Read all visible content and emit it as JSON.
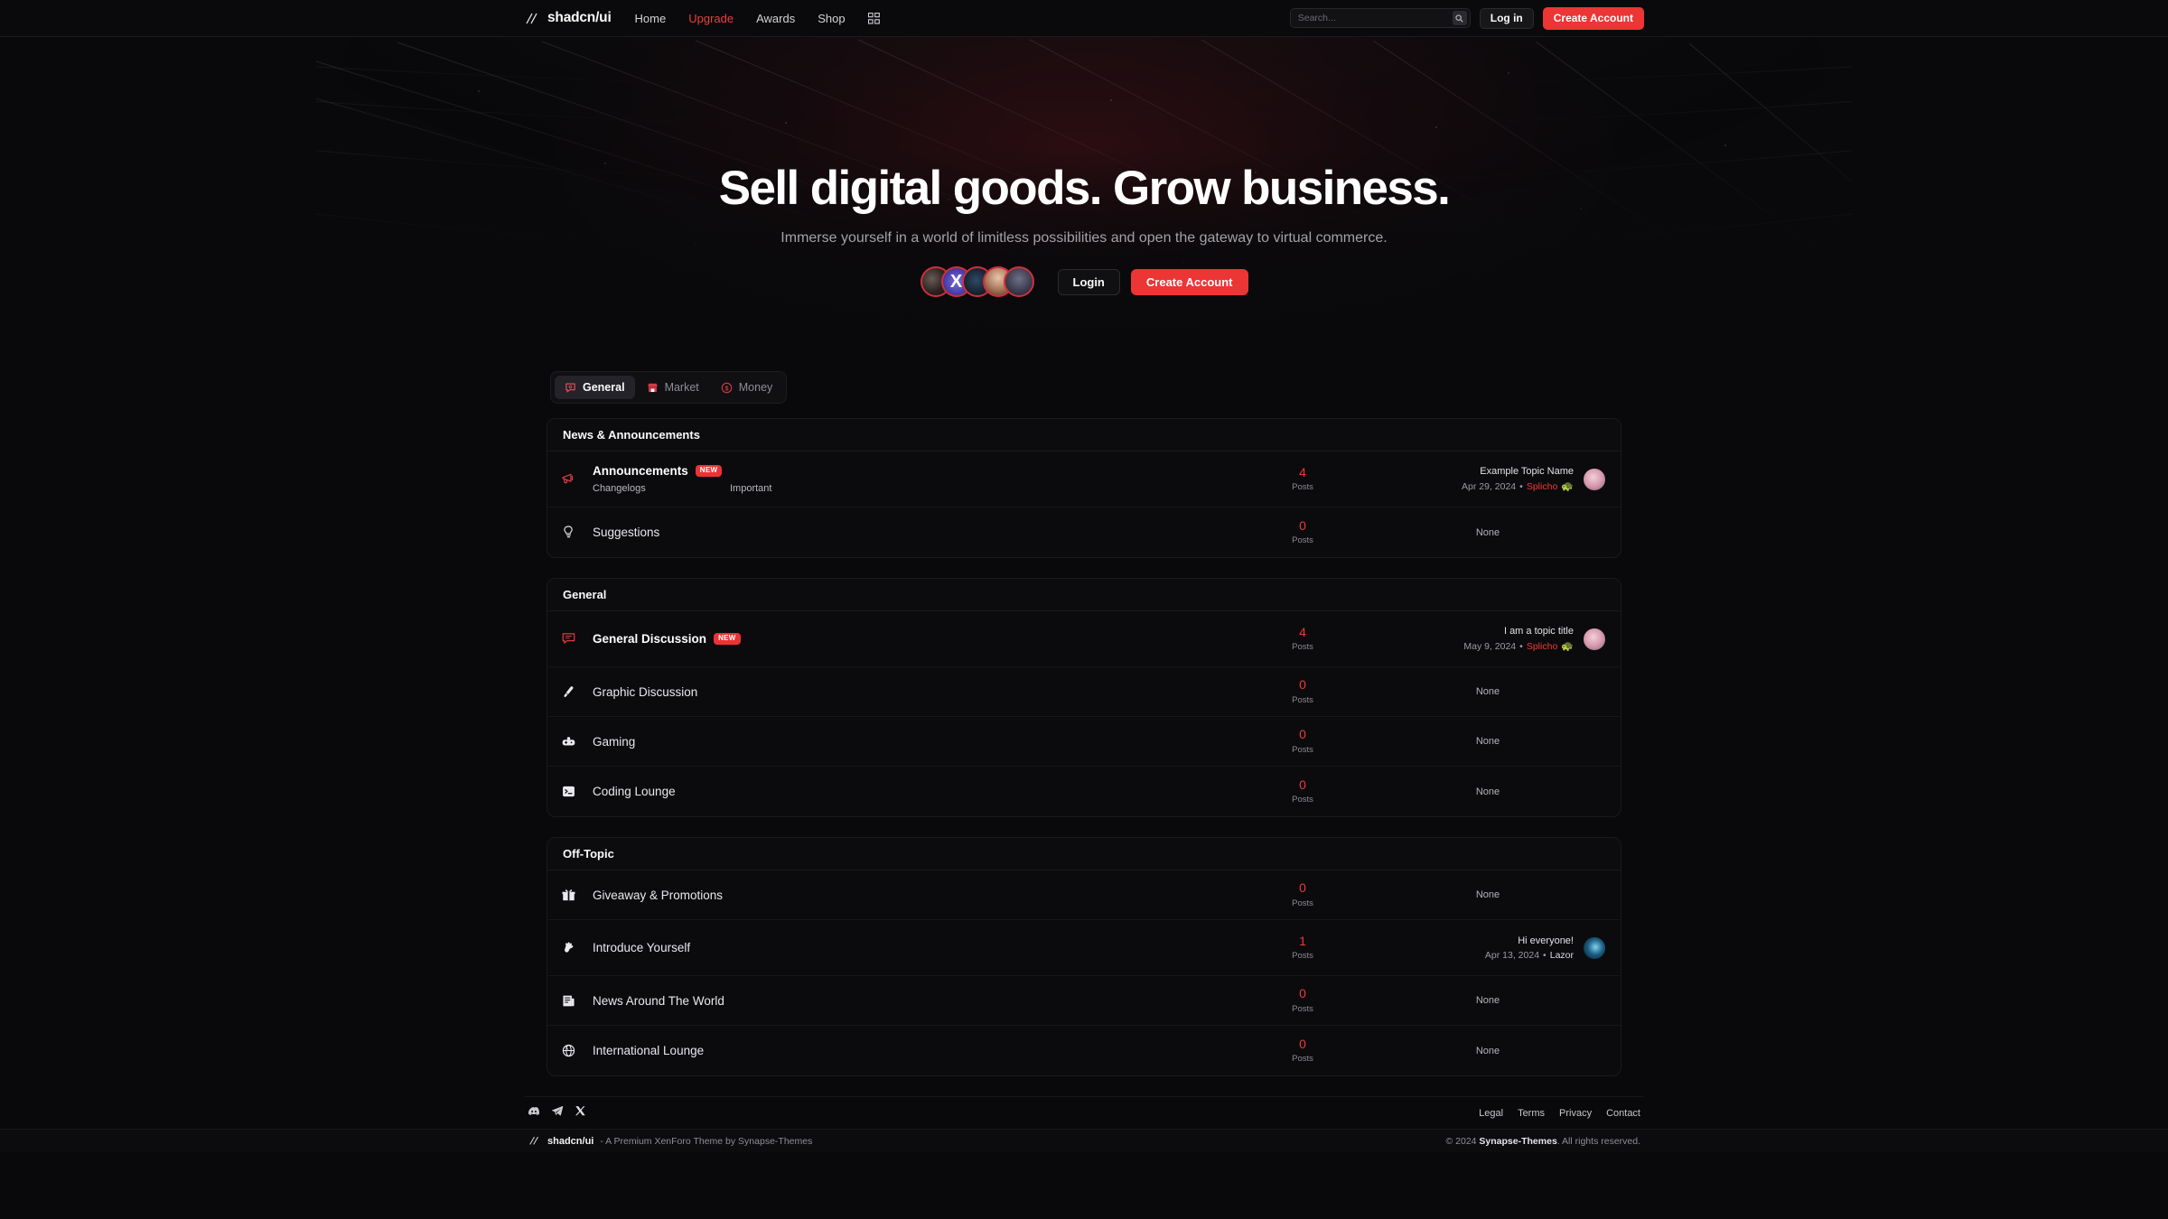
{
  "header": {
    "brand": "shadcn/ui",
    "brand_icon": "double-slash-logo",
    "nav": [
      {
        "label": "Home",
        "accent": false
      },
      {
        "label": "Upgrade",
        "accent": true
      },
      {
        "label": "Awards",
        "accent": false
      },
      {
        "label": "Shop",
        "accent": false
      }
    ],
    "apps_icon": "grid-apps-icon",
    "search": {
      "placeholder": "Search...",
      "value": "",
      "icon": "search-icon"
    },
    "login_label": "Log in",
    "create_label": "Create Account",
    "accent_color": "#ec3535"
  },
  "hero": {
    "title": "Sell digital goods. Grow business.",
    "subtitle": "Immerse yourself in a world of limitless possibilities and open the gateway to virtual commerce.",
    "login_label": "Login",
    "create_label": "Create Account",
    "avatars": [
      {
        "name": "member-avatar-1",
        "art": "art1",
        "glyph": ""
      },
      {
        "name": "member-avatar-2",
        "art": "art2",
        "glyph": "X"
      },
      {
        "name": "member-avatar-3",
        "art": "art3",
        "glyph": ""
      },
      {
        "name": "member-avatar-4",
        "art": "art4",
        "glyph": ""
      },
      {
        "name": "member-avatar-5",
        "art": "art5",
        "glyph": ""
      }
    ]
  },
  "tabs": [
    {
      "label": "General",
      "icon": "chat-bubble-icon",
      "active": true
    },
    {
      "label": "Market",
      "icon": "store-icon",
      "active": false
    },
    {
      "label": "Money",
      "icon": "dollar-circle-icon",
      "active": false
    }
  ],
  "sections": [
    {
      "title": "News & Announcements",
      "nodes": [
        {
          "title": "Announcements",
          "bold": true,
          "badge": "NEW",
          "icon": "megaphone-icon",
          "sublinks": [
            "Changelogs",
            "Important"
          ],
          "count": "4",
          "count_label": "Posts",
          "last": {
            "topic": "Example Topic Name",
            "date": "Apr 29, 2024",
            "separator": "•",
            "user": "Splicho",
            "user_accent": true,
            "emoji": "🐢",
            "avatar_art": "artS"
          }
        },
        {
          "title": "Suggestions",
          "bold": false,
          "badge": "",
          "icon": "lightbulb-icon",
          "sublinks": [],
          "count": "0",
          "count_label": "Posts",
          "last": {
            "none_label": "None"
          }
        }
      ]
    },
    {
      "title": "General",
      "nodes": [
        {
          "title": "General Discussion",
          "bold": true,
          "badge": "NEW",
          "icon": "message-lines-icon",
          "sublinks": [],
          "count": "4",
          "count_label": "Posts",
          "last": {
            "topic": "I am a topic title",
            "date": "May 9, 2024",
            "separator": "•",
            "user": "Splicho",
            "user_accent": true,
            "emoji": "🐢",
            "avatar_art": "artS"
          }
        },
        {
          "title": "Graphic Discussion",
          "bold": false,
          "badge": "",
          "icon": "paintbrush-icon",
          "sublinks": [],
          "count": "0",
          "count_label": "Posts",
          "last": {
            "none_label": "None"
          }
        },
        {
          "title": "Gaming",
          "bold": false,
          "badge": "",
          "icon": "gamepad-icon",
          "sublinks": [],
          "count": "0",
          "count_label": "Posts",
          "last": {
            "none_label": "None"
          }
        },
        {
          "title": "Coding Lounge",
          "bold": false,
          "badge": "",
          "icon": "terminal-icon",
          "sublinks": [],
          "count": "0",
          "count_label": "Posts",
          "last": {
            "none_label": "None"
          }
        }
      ]
    },
    {
      "title": "Off-Topic",
      "nodes": [
        {
          "title": "Giveaway & Promotions",
          "bold": false,
          "badge": "",
          "icon": "gift-icon",
          "sublinks": [],
          "count": "0",
          "count_label": "Posts",
          "last": {
            "none_label": "None"
          }
        },
        {
          "title": "Introduce Yourself",
          "bold": false,
          "badge": "",
          "icon": "waving-hand-icon",
          "sublinks": [],
          "count": "1",
          "count_label": "Posts",
          "last": {
            "topic": "Hi everyone!",
            "date": "Apr 13, 2024",
            "separator": "•",
            "user": "Lazor",
            "user_accent": false,
            "emoji": "",
            "avatar_art": "artL"
          }
        },
        {
          "title": "News Around The World",
          "bold": false,
          "badge": "",
          "icon": "newspaper-icon",
          "sublinks": [],
          "count": "0",
          "count_label": "Posts",
          "last": {
            "none_label": "None"
          }
        },
        {
          "title": "International Lounge",
          "bold": false,
          "badge": "",
          "icon": "globe-icon",
          "sublinks": [],
          "count": "0",
          "count_label": "Posts",
          "last": {
            "none_label": "None"
          }
        }
      ]
    }
  ],
  "footer": {
    "social": [
      {
        "name": "discord-icon",
        "label": "Discord"
      },
      {
        "name": "telegram-icon",
        "label": "Telegram"
      },
      {
        "name": "x-twitter-icon",
        "label": "X"
      }
    ],
    "links": [
      "Legal",
      "Terms",
      "Privacy",
      "Contact"
    ],
    "bar": {
      "brand": "shadcn/ui",
      "tagline": "- A Premium XenForo Theme by Synapse-Themes",
      "copyright_prefix": "© 2024 ",
      "copyright_brand": "Synapse-Themes",
      "copyright_suffix": ". All rights reserved."
    }
  }
}
